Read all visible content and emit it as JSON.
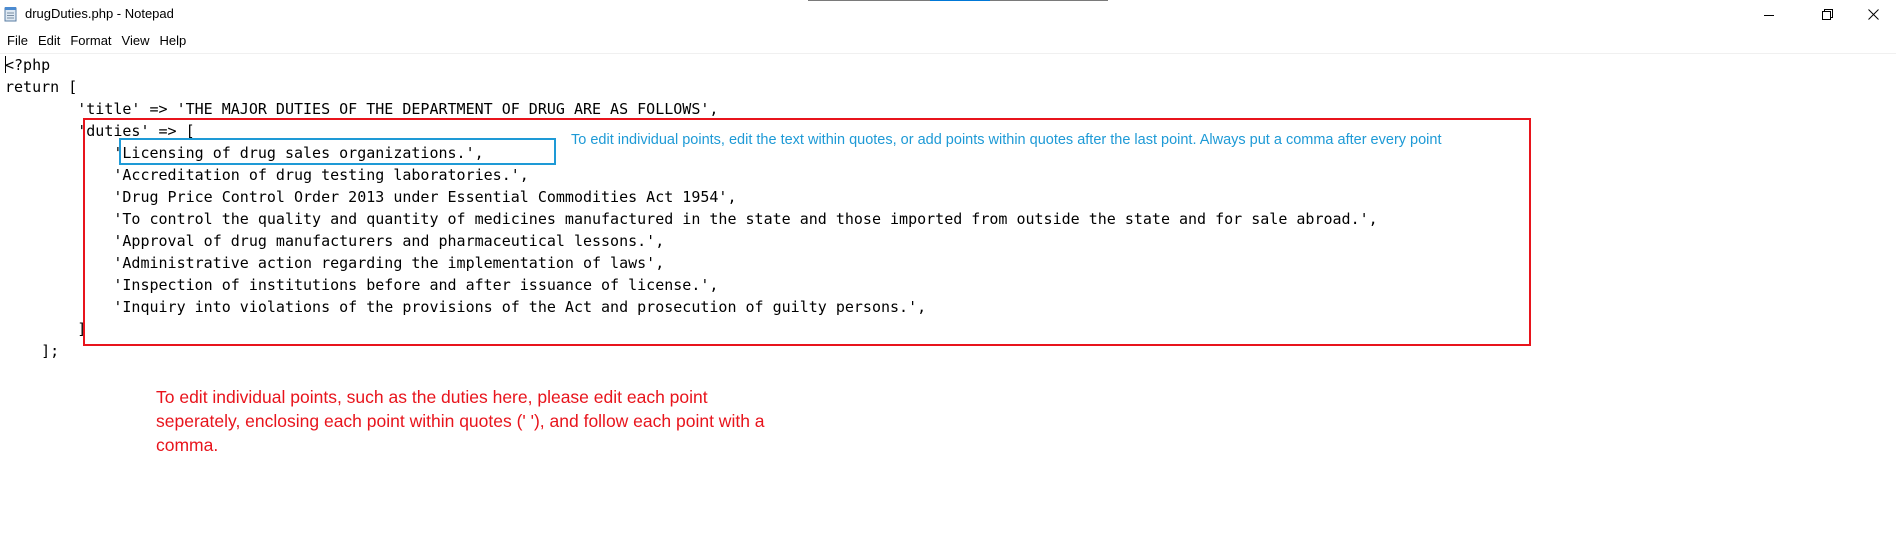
{
  "window": {
    "title": "drugDuties.php - Notepad",
    "icon": "notepad-icon"
  },
  "menu": {
    "items": [
      "File",
      "Edit",
      "Format",
      "View",
      "Help"
    ]
  },
  "code": {
    "lines": [
      "<?php",
      "return [",
      "        'title' => 'THE MAJOR DUTIES OF THE DEPARTMENT OF DRUG ARE AS FOLLOWS',",
      "        'duties' => [",
      "            'Licensing of drug sales organizations.',",
      "            'Accreditation of drug testing laboratories.',",
      "            'Drug Price Control Order 2013 under Essential Commodities Act 1954',",
      "            'To control the quality and quantity of medicines manufactured in the state and those imported from outside the state and for sale abroad.',",
      "            'Approval of drug manufacturers and pharmaceutical lessons.',",
      "            'Administrative action regarding the implementation of laws',",
      "            'Inspection of institutions before and after issuance of license.',",
      "            'Inquiry into violations of the provisions of the Act and prosecution of guilty persons.',",
      "        ]",
      "    ];"
    ]
  },
  "annotations": {
    "blue_note": "To edit individual points, edit the text within quotes, or add points within quotes after the last point. Always put a comma after every point",
    "red_note": "To edit individual points, such as the duties here, please edit each point seperately, enclosing each point within quotes (' '), and follow each point with a comma.",
    "blue_color": "#1e9ad6",
    "red_color": "#e8141c"
  }
}
